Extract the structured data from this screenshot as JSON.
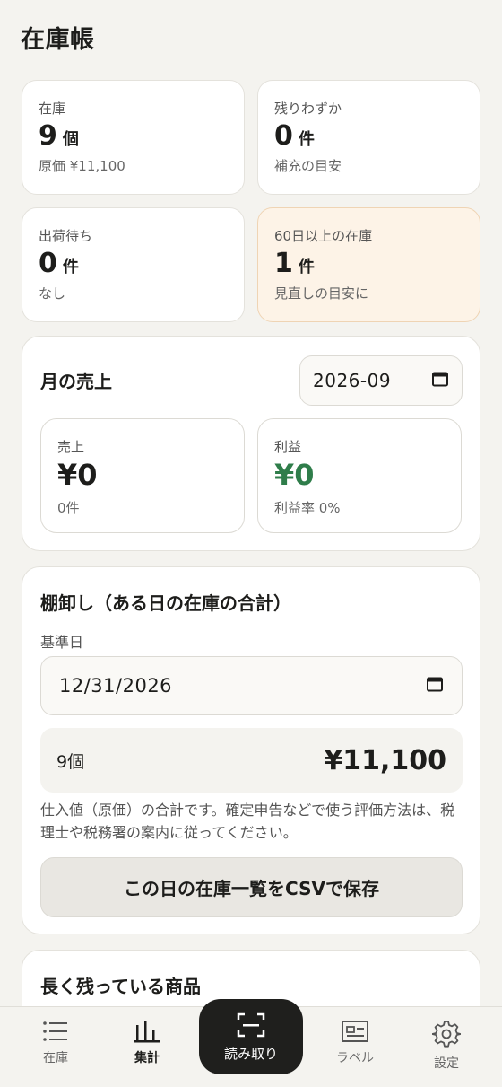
{
  "header": {
    "title": "在庫帳"
  },
  "stats": [
    {
      "label": "在庫",
      "value": "9",
      "unit": "個",
      "sub": "原価 ¥11,100"
    },
    {
      "label": "残りわずか",
      "value": "0",
      "unit": "件",
      "sub": "補充の目安"
    },
    {
      "label": "出荷待ち",
      "value": "0",
      "unit": "件",
      "sub": "なし"
    },
    {
      "label": "60日以上の在庫",
      "value": "1",
      "unit": "件",
      "sub": "見直しの目安に"
    }
  ],
  "monthly": {
    "title": "月の売上",
    "month_value": "2026-09",
    "sales": {
      "label": "売上",
      "value": "¥0",
      "sub": "0件"
    },
    "profit": {
      "label": "利益",
      "value": "¥0",
      "sub": "利益率 0%"
    }
  },
  "inventory": {
    "title": "棚卸し（ある日の在庫の合計）",
    "date_label": "基準日",
    "date_value": "12/31/2026",
    "count": "9個",
    "total": "¥11,100",
    "note": "仕入値（原価）の合計です。確定申告などで使う評価方法は、税理士や税務署の案内に従ってください。",
    "csv_button": "この日の在庫一覧をCSVで保存"
  },
  "long_stock": {
    "title": "長く残っている商品"
  },
  "nav": {
    "items": [
      {
        "label": "在庫",
        "icon": "list-icon"
      },
      {
        "label": "集計",
        "icon": "chart-icon"
      },
      {
        "label": "読み取り",
        "icon": "scan-icon"
      },
      {
        "label": "ラベル",
        "icon": "label-icon"
      },
      {
        "label": "設定",
        "icon": "gear-icon"
      }
    ]
  },
  "colors": {
    "profit": "#2f7d4a",
    "warn_bg": "#fdf3e7",
    "scan_bg": "#1f1f1d"
  }
}
